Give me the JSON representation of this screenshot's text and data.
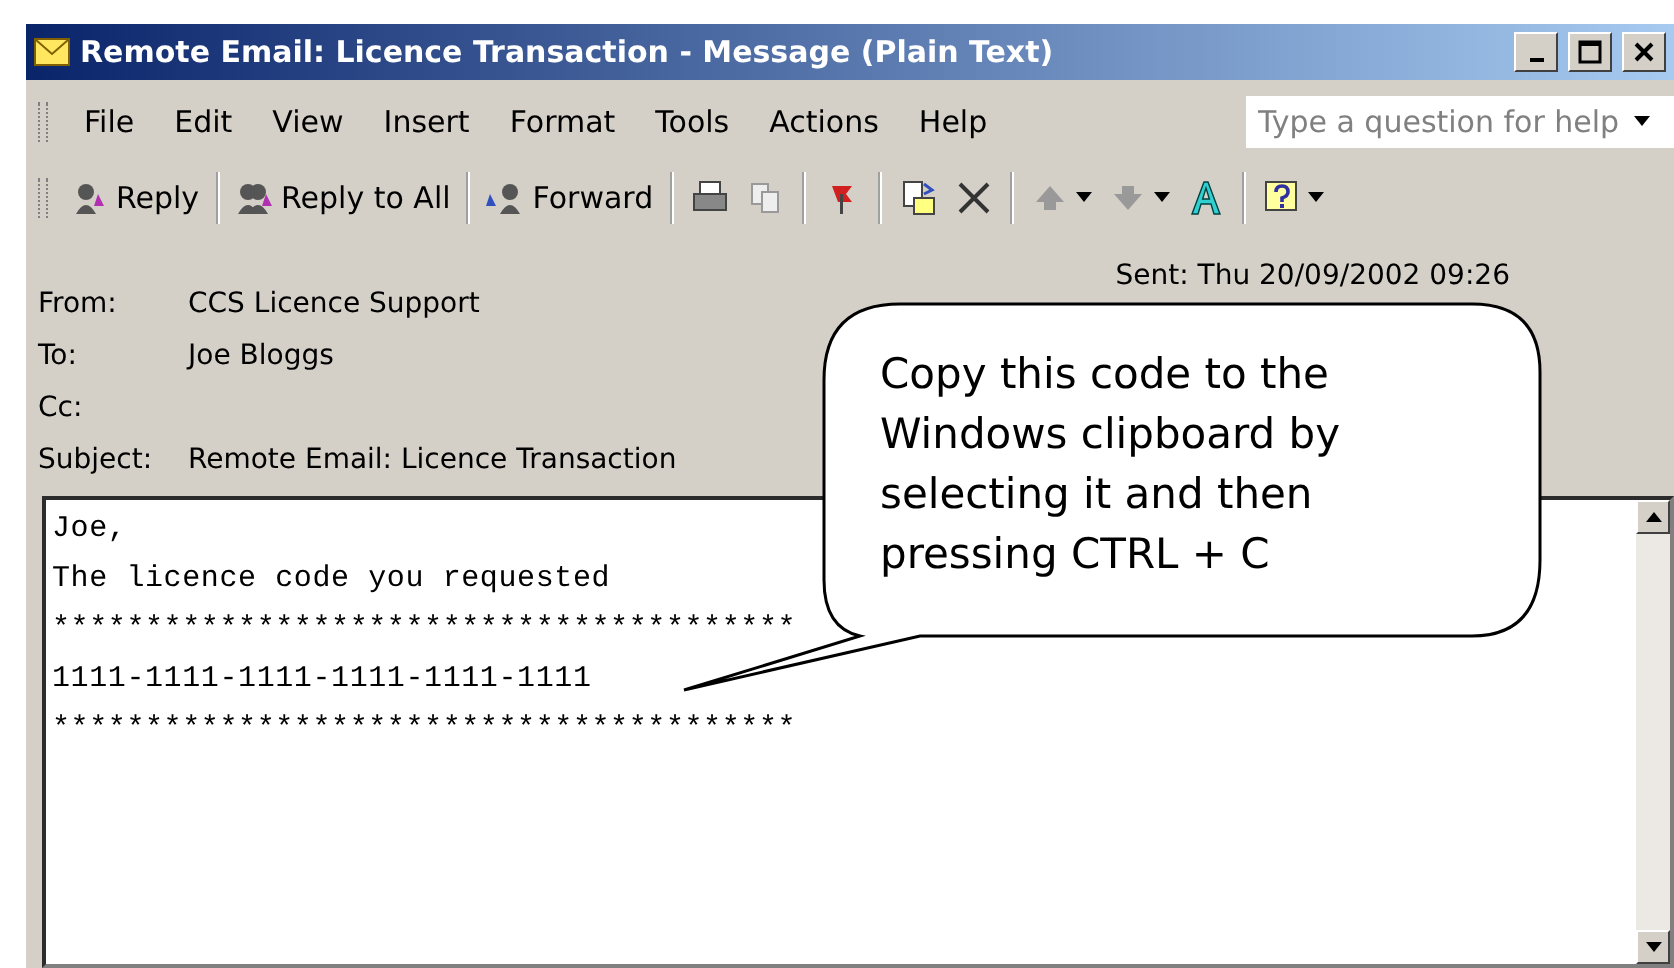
{
  "window": {
    "title": "Remote Email: Licence Transaction - Message (Plain Text)"
  },
  "menu": [
    "File",
    "Edit",
    "View",
    "Insert",
    "Format",
    "Tools",
    "Actions",
    "Help"
  ],
  "help_search": {
    "placeholder": "Type a question for help"
  },
  "toolbar": [
    "Reply",
    "Reply to All",
    "Forward"
  ],
  "headers": [
    {
      "label": "From:",
      "value": "CCS Licence Support"
    },
    {
      "label": "To:",
      "value": "Joe Bloggs"
    },
    {
      "label": "Cc:"
    },
    {
      "label": "Subject:",
      "value": "Remote Email: Licence Transaction"
    }
  ],
  "sent": "Sent:   Thu 20/09/2002 09:26",
  "body": [
    "Joe,",
    "The licence code you requested",
    "****************************************",
    "1111-1111-1111-1111-1111-1111",
    "****************************************"
  ],
  "callout": "Copy this code to the Windows clipboard by selecting it and then pressing CTRL + C"
}
